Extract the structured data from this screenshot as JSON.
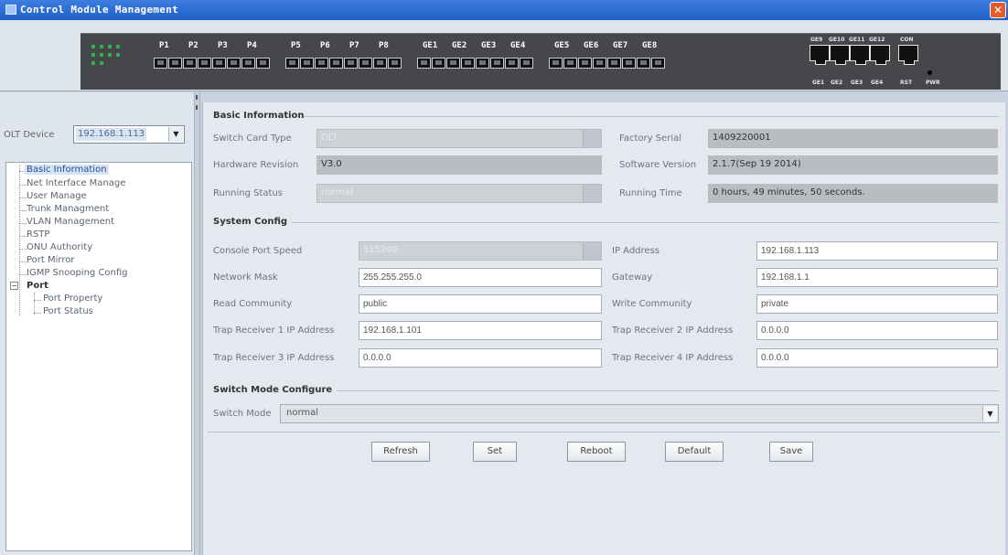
{
  "window": {
    "title": "Control Module Management",
    "close_glyph": "✕"
  },
  "device": {
    "port_labels": [
      "P1",
      "P2",
      "P3",
      "P4",
      "P5",
      "P6",
      "P7",
      "P8",
      "GE1",
      "GE2",
      "GE3",
      "GE4",
      "GE5",
      "GE6",
      "GE7",
      "GE8"
    ],
    "uplink_top_labels": [
      "GE9",
      "GE10",
      "GE11",
      "GE12",
      "CON"
    ],
    "uplink_bottom_labels": [
      "GE1",
      "GE2",
      "GE3",
      "GE4",
      "RST",
      "PWR"
    ]
  },
  "sidebar": {
    "olt_label": "OLT Device",
    "olt_value": "192.168.1.113",
    "items": [
      {
        "label": "Basic Information",
        "selected": true
      },
      {
        "label": "Net Interface Manage"
      },
      {
        "label": "User Manage"
      },
      {
        "label": "Trunk Managment"
      },
      {
        "label": "VLAN Management"
      },
      {
        "label": "RSTP"
      },
      {
        "label": "ONU Authority"
      },
      {
        "label": "Port Mirror"
      },
      {
        "label": "IGMP Snooping Config"
      }
    ],
    "port_group": {
      "label": "Port",
      "toggle": "−",
      "children": [
        "Port Property",
        "Port Status"
      ]
    }
  },
  "basic": {
    "title": "Basic Information",
    "switch_card_type_label": "Switch Card Type",
    "switch_card_type_value": "OLT",
    "factory_serial_label": "Factory Serial",
    "factory_serial_value": "1409220001",
    "hardware_revision_label": "Hardware Revision",
    "hardware_revision_value": "V3.0",
    "software_version_label": "Software Version",
    "software_version_value": "2.1.7(Sep 19 2014)",
    "running_status_label": "Running Status",
    "running_status_value": "normal",
    "running_time_label": "Running Time",
    "running_time_value": "0 hours, 49 minutes, 50 seconds."
  },
  "system": {
    "title": "System Config",
    "console_port_speed_label": "Console Port Speed",
    "console_port_speed_value": "115200",
    "ip_address_label": "IP Address",
    "ip_address_value": "192.168.1.113",
    "network_mask_label": "Network Mask",
    "network_mask_value": "255.255.255.0",
    "gateway_label": "Gateway",
    "gateway_value": "192.168.1.1",
    "read_community_label": "Read Community",
    "read_community_value": "public",
    "write_community_label": "Write Community",
    "write_community_value": "private",
    "trap1_label": "Trap Receiver 1 IP Address",
    "trap1_value": "192.168.1.101",
    "trap2_label": "Trap Receiver 2 IP Address",
    "trap2_value": "0.0.0.0",
    "trap3_label": "Trap Receiver 3 IP Address",
    "trap3_value": "0.0.0.0",
    "trap4_label": "Trap Receiver 4 IP Address",
    "trap4_value": "0.0.0.0"
  },
  "switch_mode": {
    "title": "Switch Mode Configure",
    "label": "Switch Mode",
    "value": "normal"
  },
  "buttons": {
    "refresh": "Refresh",
    "set": "Set",
    "reboot": "Reboot",
    "default": "Default",
    "save": "Save"
  },
  "glyphs": {
    "dropdown": "▼"
  }
}
